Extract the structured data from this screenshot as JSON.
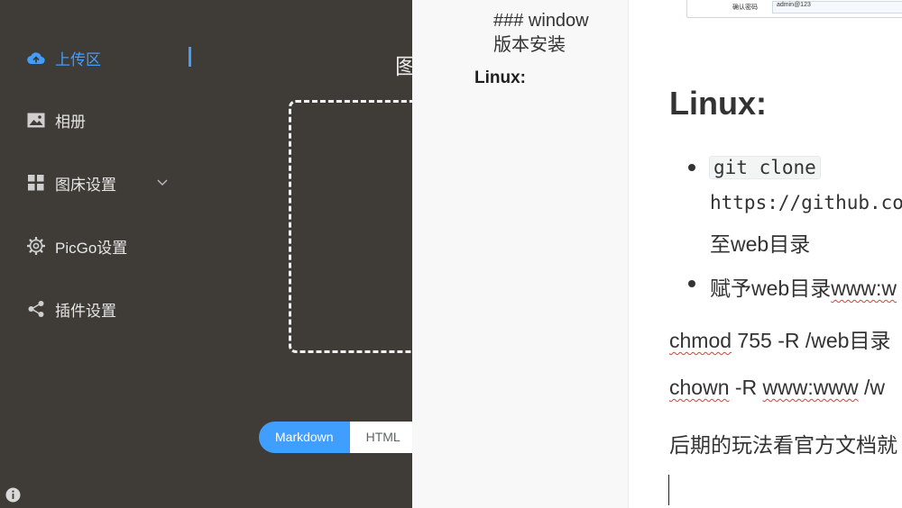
{
  "picgo": {
    "nav": [
      {
        "label": "上传区",
        "icon": "cloud-upload-icon"
      },
      {
        "label": "相册",
        "icon": "picture-icon"
      },
      {
        "label": "图床设置",
        "icon": "grid-icon"
      },
      {
        "label": "PicGo设置",
        "icon": "gear-icon"
      },
      {
        "label": "插件设置",
        "icon": "share-icon"
      }
    ],
    "upload_title": "图",
    "formats": {
      "markdown": "Markdown",
      "html": "HTML"
    },
    "colors": {
      "accent": "#409eff",
      "sidebar_bg": "#3f3b36"
    }
  },
  "editor": {
    "outline": {
      "h3": "### window 版本安装",
      "h2": "Linux:"
    },
    "image_table": {
      "label": "确认密码",
      "value": "admin@123"
    },
    "heading": "Linux:",
    "bullet1": {
      "code1": "git clone",
      "code2": "https://github.co",
      "tail": "至web目录"
    },
    "bullet2": {
      "prefix": "赋予web目录",
      "squiggled": "www:w"
    },
    "p1": {
      "word": "chmod",
      "rest": " 755 -R /web目录"
    },
    "p2": {
      "word": "chown",
      "mid": " -R ",
      "word2": "www:www",
      "rest": " /w"
    },
    "p3": "后期的玩法看官方文档就"
  }
}
